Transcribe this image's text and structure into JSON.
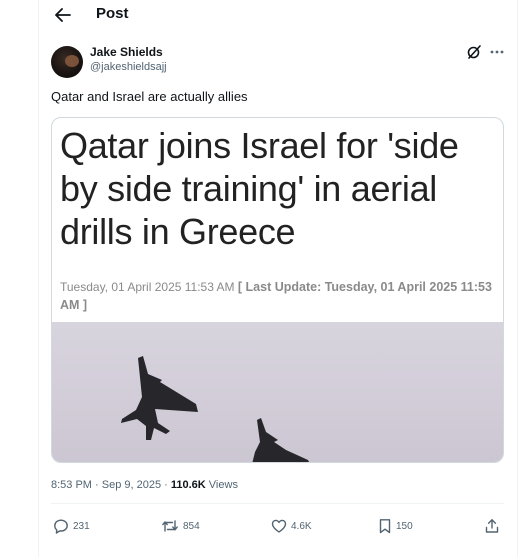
{
  "header": {
    "title": "Post",
    "back_icon": "arrow-left-icon"
  },
  "author": {
    "name": "Jake Shields",
    "handle": "@jakeshieldsajj"
  },
  "post": {
    "text": "Qatar and Israel are actually allies"
  },
  "card": {
    "headline": "Qatar joins Israel for 'side by side training' in aerial drills in Greece",
    "date": "Tuesday, 01 April 2025 11:53 AM",
    "last_update": "[ Last Update: Tuesday, 01 April 2025 11:53 AM ]"
  },
  "meta": {
    "time": "8:53 PM · Sep 9, 2025",
    "views_count": "110.6K",
    "views_label": "Views"
  },
  "actions": {
    "replies": "231",
    "reposts": "854",
    "likes": "4.6K",
    "bookmarks": "150"
  },
  "colors": {
    "text": "#0f1419",
    "secondary": "#536471",
    "border": "#cfd9de",
    "divider": "#eff3f4"
  }
}
